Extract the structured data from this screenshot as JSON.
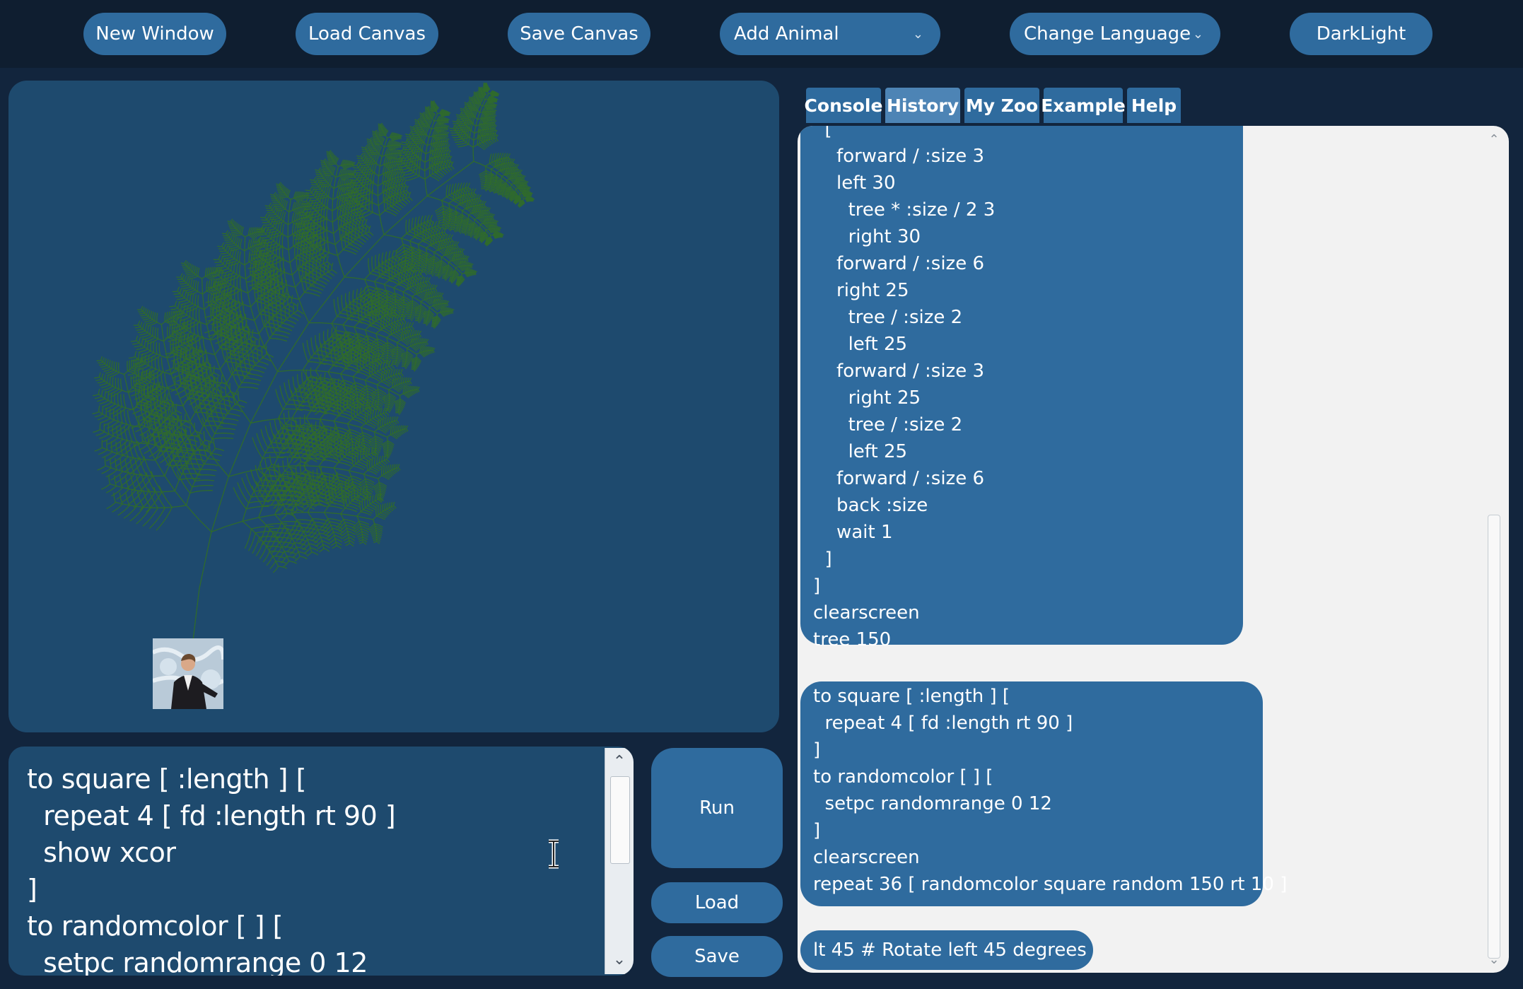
{
  "toolbar": {
    "new_window": "New Window",
    "load_canvas": "Load Canvas",
    "save_canvas": "Save Canvas",
    "add_animal": "Add Animal",
    "change_language": "Change Language",
    "dark_light": "DarkLight"
  },
  "tabs": [
    {
      "label": "Console",
      "active": false
    },
    {
      "label": "History",
      "active": true
    },
    {
      "label": "My Zoo",
      "active": false
    },
    {
      "label": "Example",
      "active": false
    },
    {
      "label": "Help",
      "active": false
    }
  ],
  "editor": {
    "code": "to square [ :length ] [\n  repeat 4 [ fd :length rt 90 ]\n  show xcor\n]\nto randomcolor [ ] [\n  setpc randomrange 0 12"
  },
  "actions": {
    "run": "Run",
    "load": "Load",
    "save": "Save"
  },
  "console": {
    "entry1": "  [\n    forward / :size 3\n    left 30\n      tree * :size / 2 3\n      right 30\n    forward / :size 6\n    right 25\n      tree / :size 2\n      left 25\n    forward / :size 3\n      right 25\n      tree / :size 2\n      left 25\n    forward / :size 6\n    back :size\n    wait 1\n  ]\n]\nclearscreen\ntree 150",
    "entry2": "to square [ :length ] [\n  repeat 4 [ fd :length rt 90 ]\n]\nto randomcolor [ ] [\n  setpc randomrange 0 12\n]\nclearscreen\nrepeat 36 [ randomcolor square random 150 rt 10 ]",
    "entry3": "lt 45 # Rotate left 45 degrees"
  },
  "colors": {
    "background": "#12253d",
    "toolbar": "#0f1e30",
    "accent": "#2f6b9e",
    "tab_active": "#4d84b5",
    "panel": "#1e4a6e",
    "tree": "#2f6a2c"
  }
}
